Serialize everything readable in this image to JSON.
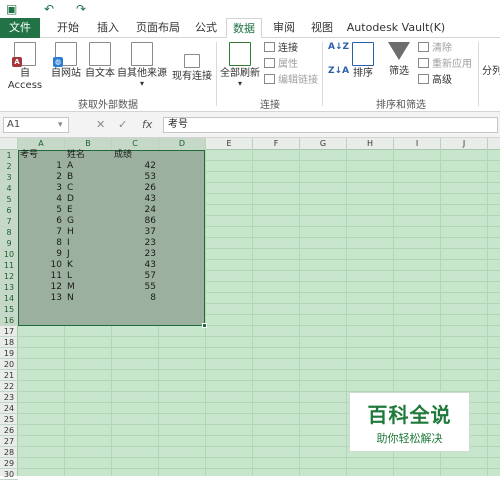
{
  "quick_access": {
    "save_icon": "save-icon",
    "undo_icon": "undo-icon",
    "redo_icon": "redo-icon"
  },
  "tabs": [
    "文件",
    "开始",
    "插入",
    "页面布局",
    "公式",
    "数据",
    "审阅",
    "视图",
    "Autodesk Vault(K)"
  ],
  "active_tab": "数据",
  "ribbon": {
    "external_group": {
      "label": "获取外部数据",
      "buttons": [
        "自 Access",
        "自网站",
        "自文本",
        "自其他来源",
        "现有连接"
      ]
    },
    "connections_group": {
      "label": "连接",
      "refresh": "全部刷新",
      "items": [
        "连接",
        "属性",
        "编辑链接"
      ]
    },
    "sort_group": {
      "label": "排序和筛选",
      "sort": "排序",
      "filter": "筛选",
      "items": [
        "清除",
        "重新应用",
        "高级"
      ]
    },
    "overflow": "分列"
  },
  "formula_bar": {
    "name_box": "A1",
    "fx": "fx",
    "cancel": "✕",
    "enter": "✓",
    "value": "考号"
  },
  "columns": [
    "A",
    "B",
    "C",
    "D",
    "E",
    "F",
    "G",
    "H",
    "I",
    "J"
  ],
  "rows": [
    "1",
    "2",
    "3",
    "4",
    "5",
    "6",
    "7",
    "8",
    "9",
    "10",
    "11",
    "12",
    "13",
    "14",
    "15",
    "16",
    "17",
    "18",
    "19",
    "20",
    "21",
    "22",
    "23",
    "24",
    "25",
    "26",
    "27",
    "28",
    "29",
    "30"
  ],
  "sheet": {
    "headers": [
      "考号",
      "姓名",
      "成绩"
    ],
    "data": [
      [
        "1",
        "A",
        "42"
      ],
      [
        "2",
        "B",
        "53"
      ],
      [
        "3",
        "C",
        "26"
      ],
      [
        "4",
        "D",
        "43"
      ],
      [
        "5",
        "E",
        "24"
      ],
      [
        "6",
        "G",
        "86"
      ],
      [
        "7",
        "H",
        "37"
      ],
      [
        "8",
        "I",
        "23"
      ],
      [
        "9",
        "J",
        "23"
      ],
      [
        "10",
        "K",
        "43"
      ],
      [
        "11",
        "L",
        "57"
      ],
      [
        "12",
        "M",
        "55"
      ],
      [
        "13",
        "N",
        "8"
      ]
    ]
  },
  "watermark": {
    "title": "百科全说",
    "subtitle": "助你轻松解决"
  },
  "colors": {
    "excel_green": "#217346",
    "selection": "#9cb09f",
    "grid_bg": "#c8e6cc"
  }
}
